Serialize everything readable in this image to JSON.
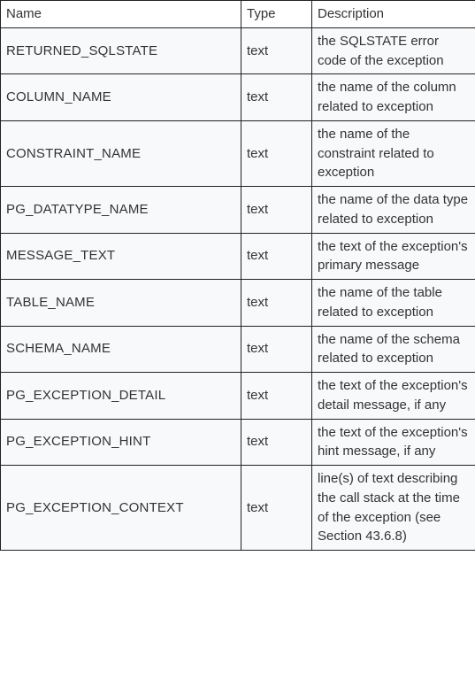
{
  "table": {
    "headers": {
      "name": "Name",
      "type": "Type",
      "description": "Description"
    },
    "rows": [
      {
        "name": "RETURNED_SQLSTATE",
        "type": "text",
        "description": "the SQLSTATE error code of the exception"
      },
      {
        "name": "COLUMN_NAME",
        "type": "text",
        "description": "the name of the column related to exception"
      },
      {
        "name": "CONSTRAINT_NAME",
        "type": "text",
        "description": "the name of the constraint related to exception"
      },
      {
        "name": "PG_DATATYPE_NAME",
        "type": "text",
        "description": "the name of the data type related to exception"
      },
      {
        "name": "MESSAGE_TEXT",
        "type": "text",
        "description": "the text of the exception's primary message"
      },
      {
        "name": "TABLE_NAME",
        "type": "text",
        "description": "the name of the table related to exception"
      },
      {
        "name": "SCHEMA_NAME",
        "type": "text",
        "description": "the name of the schema related to exception"
      },
      {
        "name": "PG_EXCEPTION_DETAIL",
        "type": "text",
        "description": "the text of the exception's detail message, if any"
      },
      {
        "name": "PG_EXCEPTION_HINT",
        "type": "text",
        "description": "the text of the exception's hint message, if any"
      },
      {
        "name": "PG_EXCEPTION_CONTEXT",
        "type": "text",
        "description": "line(s) of text describing the call stack at the time of the exception (see Section 43.6.8)"
      }
    ]
  }
}
